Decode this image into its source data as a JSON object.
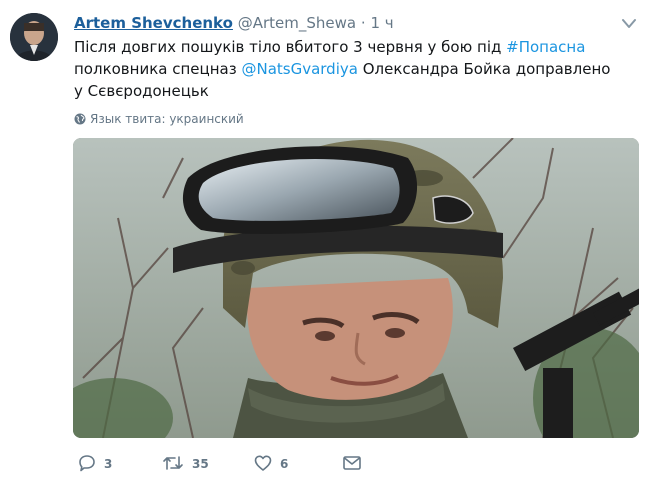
{
  "tweet": {
    "author_name": "Artem Shevchenko",
    "author_handle": "@Artem_Shewa",
    "separator": "·",
    "time": "1 ч",
    "text_part1": "Після довгих пошуків тіло вбитого 3 червня у бою під ",
    "hashtag": "#Попасна",
    "text_part2": " полковника спецназ ",
    "mention": "@NatsGvardiya",
    "text_part3": " Олександра Бойка доправлено у Сєвєродонецьк",
    "language_label": "Язык твита: украинский",
    "actions": {
      "reply_count": "3",
      "retweet_count": "35",
      "like_count": "6"
    },
    "icons": [
      "avatar",
      "chevron-down-icon",
      "globe-icon",
      "reply-icon",
      "retweet-icon",
      "like-icon",
      "message-icon"
    ],
    "colors": {
      "name": "#1c5f9b",
      "link": "#1b95e0",
      "meta": "#657786",
      "text": "#14171a"
    }
  }
}
